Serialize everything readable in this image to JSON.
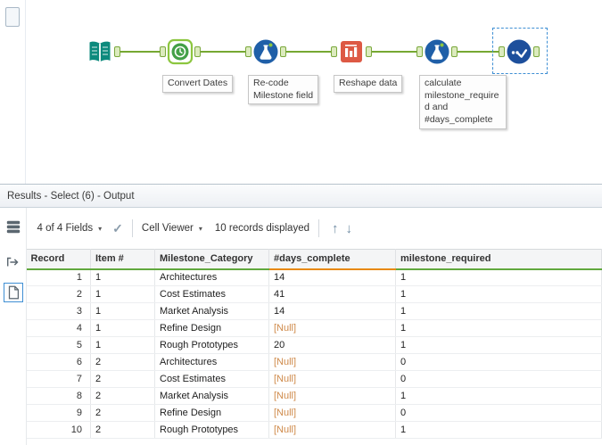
{
  "colors": {
    "connector_green": "#76a832",
    "tool_blue": "#1f5fa8",
    "tool_teal": "#0d8a7d",
    "tool_orange": "#dd5944",
    "tool_green": "#43a047",
    "selection_blue": "#3f8fd4",
    "null_text": "#cf8a4a",
    "header_underline_green": "#61a83e",
    "header_underline_orange": "#e8890c"
  },
  "canvas": {
    "tools": [
      {
        "name": "input-data",
        "icon": "book-icon",
        "label": ""
      },
      {
        "name": "convert-dates",
        "icon": "datetime-icon",
        "label": "Convert Dates"
      },
      {
        "name": "recode-milestone",
        "icon": "formula-flask-icon",
        "label": "Re-code\nMilestone field"
      },
      {
        "name": "reshape-data",
        "icon": "reshape-icon",
        "label": "Reshape data"
      },
      {
        "name": "calculate-fields",
        "icon": "formula-flask-icon",
        "label": "calculate\nmilestone_require\nd and\n#days_complete"
      },
      {
        "name": "select",
        "icon": "check-icon",
        "label": ""
      }
    ]
  },
  "results": {
    "title": "Results - Select (6) - Output",
    "toolbar": {
      "fields": "4 of 4 Fields",
      "cell_viewer": "Cell Viewer",
      "records": "10 records displayed"
    },
    "table": {
      "columns": [
        "Record",
        "Item #",
        "Milestone_Category",
        "#days_complete",
        "milestone_required"
      ],
      "rows": [
        [
          "1",
          "1",
          "Architectures",
          "14",
          "1"
        ],
        [
          "2",
          "1",
          "Cost Estimates",
          "41",
          "1"
        ],
        [
          "3",
          "1",
          "Market Analysis",
          "14",
          "1"
        ],
        [
          "4",
          "1",
          "Refine Design",
          "[Null]",
          "1"
        ],
        [
          "5",
          "1",
          "Rough Prototypes",
          "20",
          "1"
        ],
        [
          "6",
          "2",
          "Architectures",
          "[Null]",
          "0"
        ],
        [
          "7",
          "2",
          "Cost Estimates",
          "[Null]",
          "0"
        ],
        [
          "8",
          "2",
          "Market Analysis",
          "[Null]",
          "1"
        ],
        [
          "9",
          "2",
          "Refine Design",
          "[Null]",
          "0"
        ],
        [
          "10",
          "2",
          "Rough Prototypes",
          "[Null]",
          "1"
        ]
      ]
    }
  }
}
